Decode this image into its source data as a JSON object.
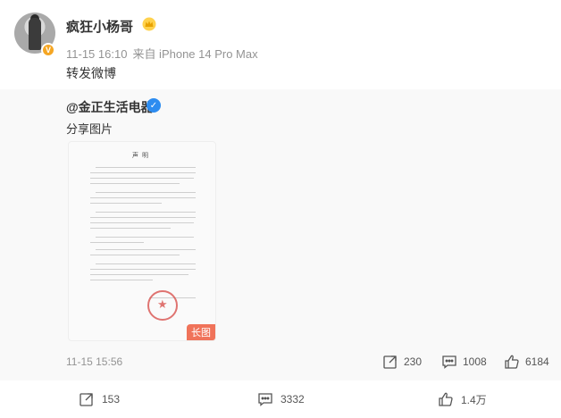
{
  "post": {
    "username": "疯狂小杨哥",
    "avatar_badge": "V",
    "time": "11-15 16:10",
    "source": "来自 iPhone 14 Pro Max",
    "content": "转发微博"
  },
  "repost": {
    "author": "@金正生活电器",
    "text": "分享图片",
    "image_tag": "长图",
    "doc_title": "声明",
    "time": "11-15 15:56",
    "actions": {
      "forward_count": "230",
      "comment_count": "1008",
      "like_count": "6184"
    }
  },
  "footer": {
    "forward_count": "153",
    "comment_count": "3332",
    "like_count": "1.4万"
  },
  "colors": {
    "meta_gray": "#939393",
    "repost_bg": "#f9f9f9",
    "long_tag": "#f0735a",
    "verified_blue": "#2d8cf0",
    "badge_orange": "#f5a623"
  }
}
